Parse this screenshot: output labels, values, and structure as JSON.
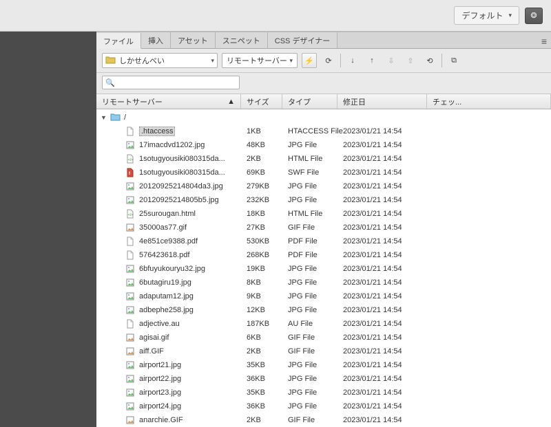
{
  "workspace": {
    "label": "デフォルト"
  },
  "panel": {
    "tabs": [
      "ファイル",
      "挿入",
      "アセット",
      "スニペット",
      "CSS デザイナー"
    ],
    "active_tab": 0,
    "site_dropdown": "しかせんべい",
    "server_dropdown": "リモートサーバー",
    "filter_placeholder": ""
  },
  "columns": {
    "name": "リモートサーバー",
    "size": "サイズ",
    "type": "タイプ",
    "modified": "修正日",
    "checked": "チェッ..."
  },
  "root_label": "/",
  "files": [
    {
      "icon": "generic",
      "name": ".htaccess",
      "size": "1KB",
      "type": "HTACCESS File",
      "date": "2023/01/21 14:54",
      "selected": true
    },
    {
      "icon": "jpg",
      "name": "17imacdvd1202.jpg",
      "size": "48KB",
      "type": "JPG File",
      "date": "2023/01/21 14:54"
    },
    {
      "icon": "html",
      "name": "1sotugyousiki080315da...",
      "size": "2KB",
      "type": "HTML File",
      "date": "2023/01/21 14:54"
    },
    {
      "icon": "swf",
      "name": "1sotugyousiki080315da...",
      "size": "69KB",
      "type": "SWF File",
      "date": "2023/01/21 14:54"
    },
    {
      "icon": "jpg",
      "name": "20120925214804da3.jpg",
      "size": "279KB",
      "type": "JPG File",
      "date": "2023/01/21 14:54"
    },
    {
      "icon": "jpg",
      "name": "20120925214805b5.jpg",
      "size": "232KB",
      "type": "JPG File",
      "date": "2023/01/21 14:54"
    },
    {
      "icon": "html",
      "name": "25surougan.html",
      "size": "18KB",
      "type": "HTML File",
      "date": "2023/01/21 14:54"
    },
    {
      "icon": "gif",
      "name": "35000as77.gif",
      "size": "27KB",
      "type": "GIF File",
      "date": "2023/01/21 14:54"
    },
    {
      "icon": "pdf",
      "name": "4e851ce9388.pdf",
      "size": "530KB",
      "type": "PDF File",
      "date": "2023/01/21 14:54"
    },
    {
      "icon": "pdf",
      "name": "576423618.pdf",
      "size": "268KB",
      "type": "PDF File",
      "date": "2023/01/21 14:54"
    },
    {
      "icon": "jpg",
      "name": "6bfuyukouryu32.jpg",
      "size": "19KB",
      "type": "JPG File",
      "date": "2023/01/21 14:54"
    },
    {
      "icon": "jpg",
      "name": "6butagiru19.jpg",
      "size": "8KB",
      "type": "JPG File",
      "date": "2023/01/21 14:54"
    },
    {
      "icon": "jpg",
      "name": "adaputam12.jpg",
      "size": "9KB",
      "type": "JPG File",
      "date": "2023/01/21 14:54"
    },
    {
      "icon": "jpg",
      "name": "adbephe258.jpg",
      "size": "12KB",
      "type": "JPG File",
      "date": "2023/01/21 14:54"
    },
    {
      "icon": "generic",
      "name": "adjective.au",
      "size": "187KB",
      "type": "AU File",
      "date": "2023/01/21 14:54"
    },
    {
      "icon": "gif",
      "name": "agisai.gif",
      "size": "6KB",
      "type": "GIF File",
      "date": "2023/01/21 14:54"
    },
    {
      "icon": "gif",
      "name": "aiff.GIF",
      "size": "2KB",
      "type": "GIF File",
      "date": "2023/01/21 14:54"
    },
    {
      "icon": "jpg",
      "name": "airport21.jpg",
      "size": "35KB",
      "type": "JPG File",
      "date": "2023/01/21 14:54"
    },
    {
      "icon": "jpg",
      "name": "airport22.jpg",
      "size": "36KB",
      "type": "JPG File",
      "date": "2023/01/21 14:54"
    },
    {
      "icon": "jpg",
      "name": "airport23.jpg",
      "size": "35KB",
      "type": "JPG File",
      "date": "2023/01/21 14:54"
    },
    {
      "icon": "jpg",
      "name": "airport24.jpg",
      "size": "36KB",
      "type": "JPG File",
      "date": "2023/01/21 14:54"
    },
    {
      "icon": "gif",
      "name": "anarchie.GIF",
      "size": "2KB",
      "type": "GIF File",
      "date": "2023/01/21 14:54"
    }
  ]
}
